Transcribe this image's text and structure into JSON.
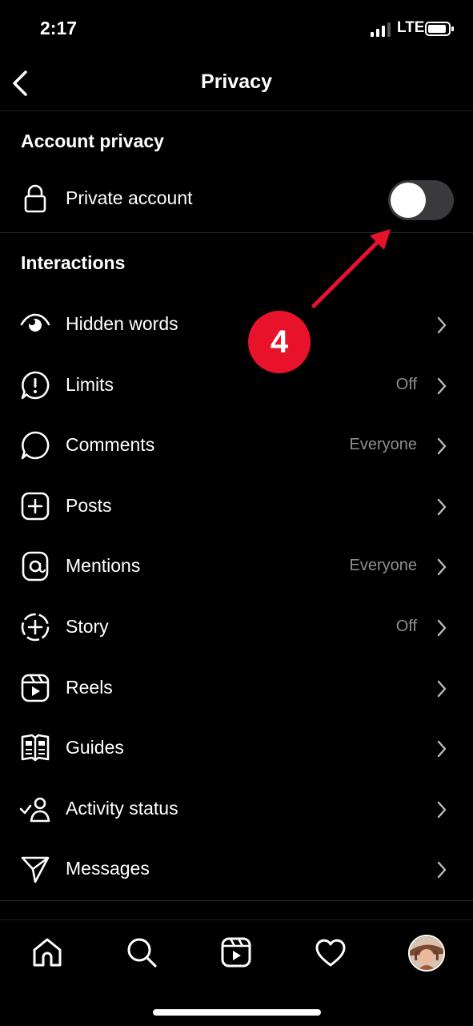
{
  "status_bar": {
    "time": "2:17",
    "network": "LTE"
  },
  "header": {
    "title": "Privacy"
  },
  "account_privacy": {
    "section_title": "Account privacy",
    "private_account": {
      "label": "Private account",
      "enabled": false
    }
  },
  "interactions": {
    "section_title": "Interactions",
    "items": [
      {
        "label": "Hidden words",
        "value": "",
        "icon": "hidden-words-icon"
      },
      {
        "label": "Limits",
        "value": "Off",
        "icon": "limits-icon"
      },
      {
        "label": "Comments",
        "value": "Everyone",
        "icon": "comment-icon"
      },
      {
        "label": "Posts",
        "value": "",
        "icon": "plus-square-icon"
      },
      {
        "label": "Mentions",
        "value": "Everyone",
        "icon": "at-sign-icon"
      },
      {
        "label": "Story",
        "value": "Off",
        "icon": "story-add-icon"
      },
      {
        "label": "Reels",
        "value": "",
        "icon": "reels-icon"
      },
      {
        "label": "Guides",
        "value": "",
        "icon": "guides-icon"
      },
      {
        "label": "Activity status",
        "value": "",
        "icon": "activity-status-icon"
      },
      {
        "label": "Messages",
        "value": "",
        "icon": "send-icon"
      }
    ]
  },
  "annotation": {
    "step": "4",
    "color": "#e8132a"
  },
  "tab_bar": {
    "items": [
      "home-icon",
      "search-icon",
      "reels-icon",
      "heart-icon",
      "profile-avatar"
    ]
  }
}
